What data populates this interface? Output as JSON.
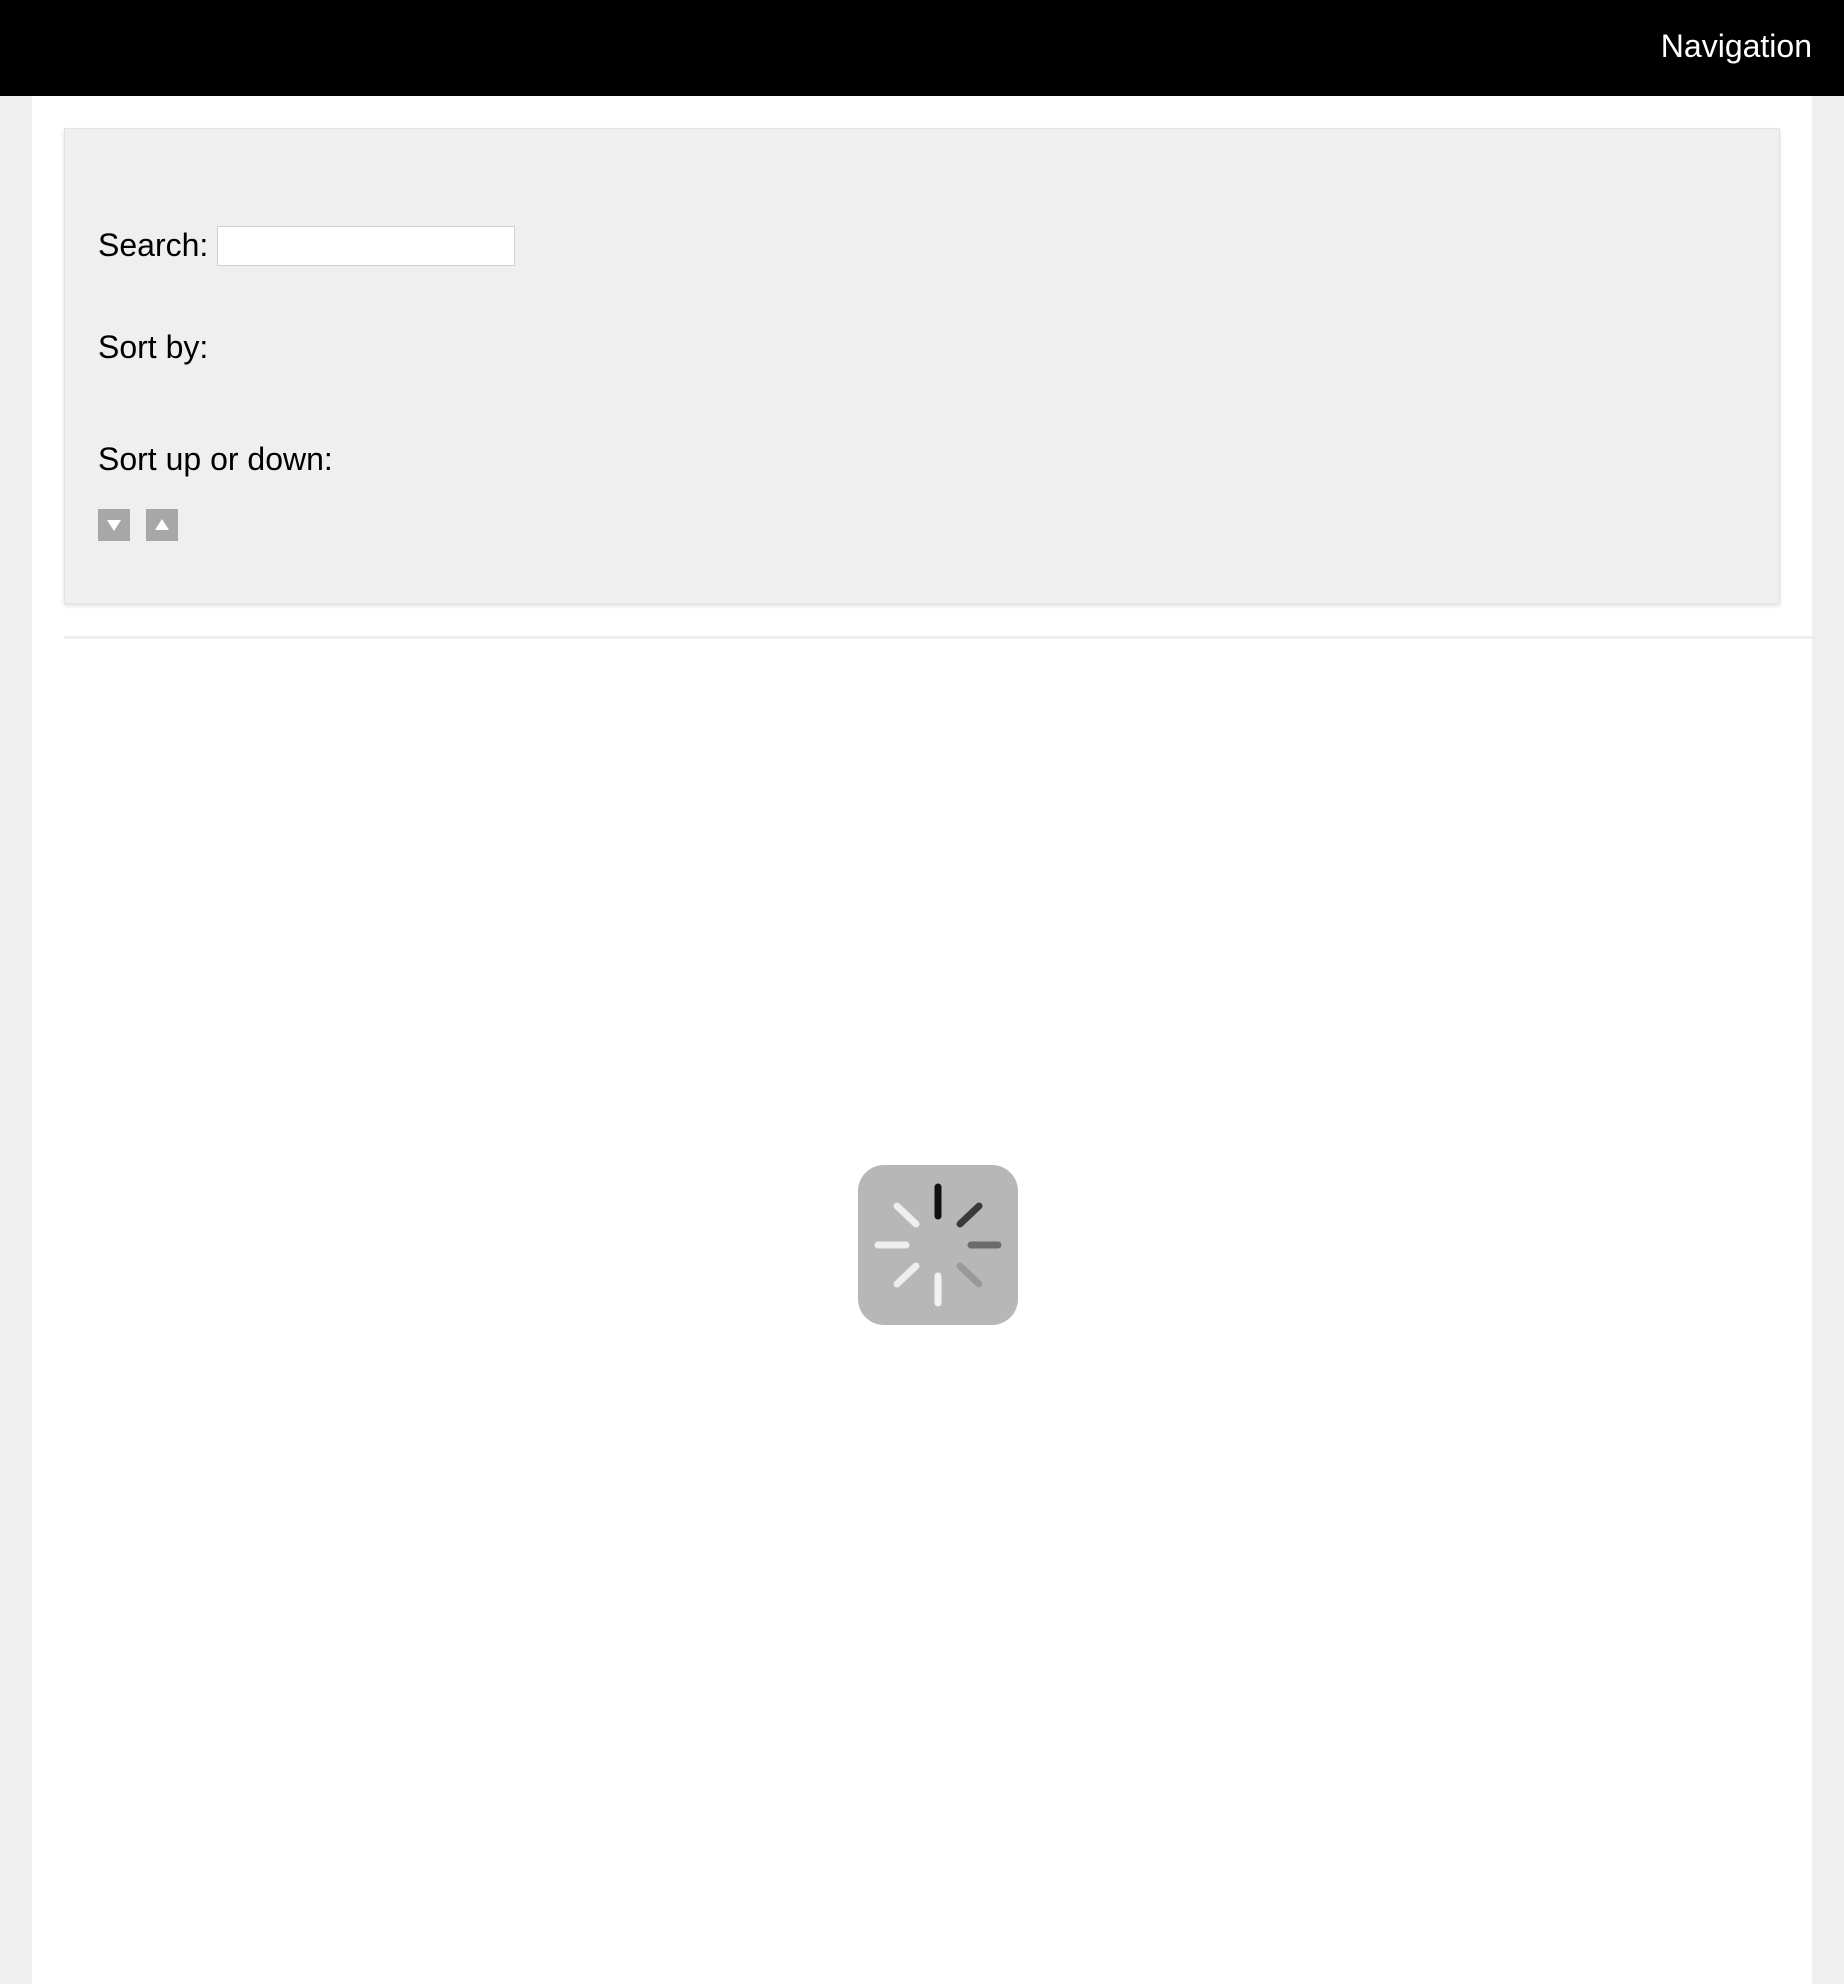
{
  "header": {
    "nav_label": "Navigation",
    "background": "#000000"
  },
  "filters": {
    "search_label": "Search:",
    "search_value": "",
    "sort_by_label": "Sort by:",
    "sort_direction_label": "Sort up or down:",
    "sort_desc_icon": "triangle-down-icon",
    "sort_asc_icon": "triangle-up-icon"
  },
  "content": {
    "loading_icon": "loading-spinner-icon"
  },
  "colors": {
    "page_background": "#efefef",
    "panel_background": "#efefef",
    "button_gray": "#a7a7a7",
    "spinner_background": "#b7b7b7"
  }
}
